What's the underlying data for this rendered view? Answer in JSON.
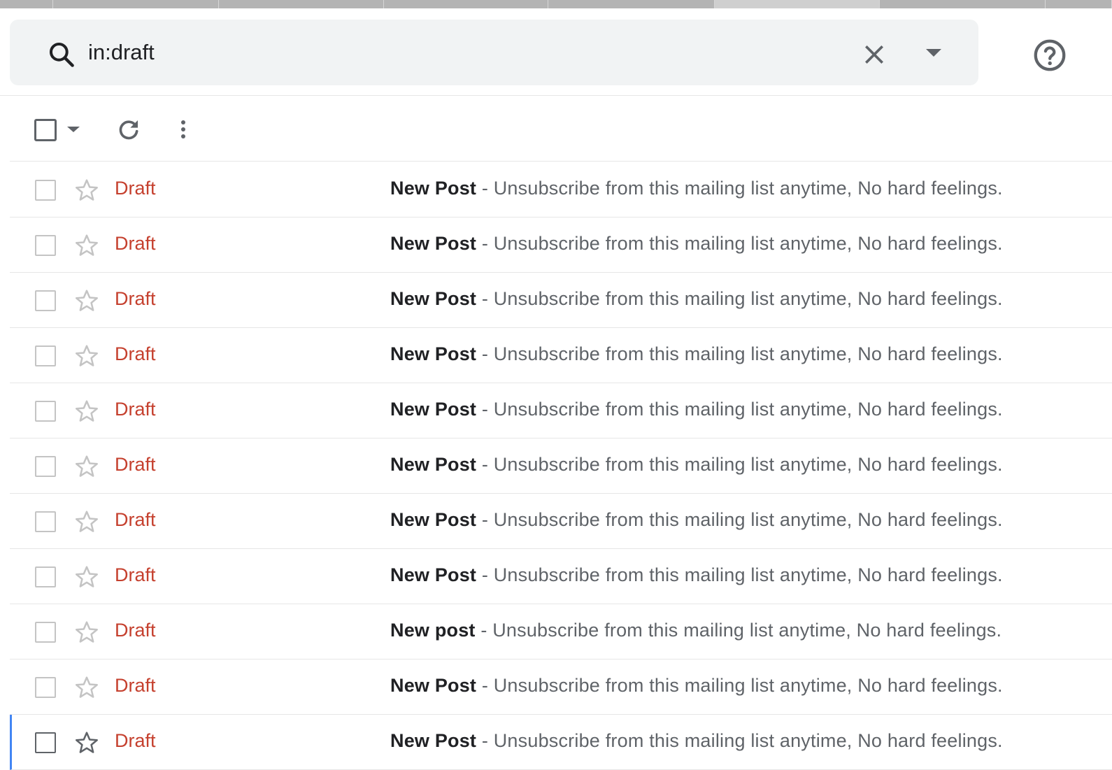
{
  "search": {
    "query": "in:draft"
  },
  "icons": {
    "search": "search-icon",
    "clear": "close-icon",
    "search_options": "caret-down-icon",
    "help": "help-circle-icon",
    "select": "checkbox-icon",
    "refresh": "refresh-icon",
    "more": "more-vertical-icon",
    "star": "star-outline-icon"
  },
  "colors": {
    "draft_label": "#c5402e",
    "search_bg": "#f1f3f4",
    "accent": "#4285f4"
  },
  "messages": [
    {
      "sender": "Draft",
      "subject": "New Post",
      "snippet": " - Unsubscribe from this mailing list anytime, No hard feelings."
    },
    {
      "sender": "Draft",
      "subject": "New Post",
      "snippet": " - Unsubscribe from this mailing list anytime, No hard feelings."
    },
    {
      "sender": "Draft",
      "subject": "New Post",
      "snippet": " - Unsubscribe from this mailing list anytime, No hard feelings."
    },
    {
      "sender": "Draft",
      "subject": "New Post",
      "snippet": " - Unsubscribe from this mailing list anytime, No hard feelings."
    },
    {
      "sender": "Draft",
      "subject": "New Post",
      "snippet": " - Unsubscribe from this mailing list anytime, No hard feelings."
    },
    {
      "sender": "Draft",
      "subject": "New Post",
      "snippet": " - Unsubscribe from this mailing list anytime, No hard feelings."
    },
    {
      "sender": "Draft",
      "subject": "New Post",
      "snippet": " - Unsubscribe from this mailing list anytime, No hard feelings."
    },
    {
      "sender": "Draft",
      "subject": "New Post",
      "snippet": " - Unsubscribe from this mailing list anytime, No hard feelings."
    },
    {
      "sender": "Draft",
      "subject": "New post",
      "snippet": " - Unsubscribe from this mailing list anytime, No hard feelings."
    },
    {
      "sender": "Draft",
      "subject": "New Post",
      "snippet": " - Unsubscribe from this mailing list anytime, No hard feelings."
    },
    {
      "sender": "Draft",
      "subject": "New Post",
      "snippet": " - Unsubscribe from this mailing list anytime, No hard feelings."
    }
  ]
}
